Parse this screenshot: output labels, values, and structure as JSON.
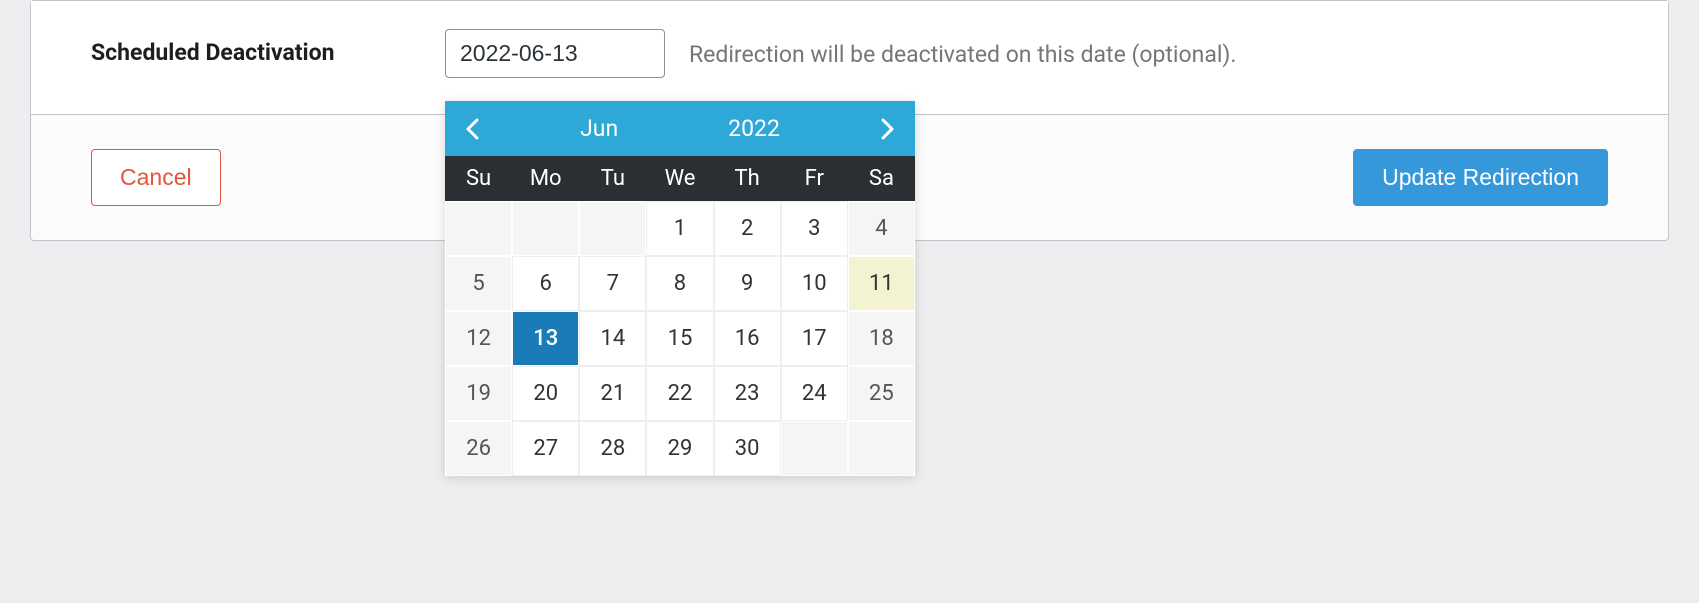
{
  "form": {
    "label": "Scheduled Deactivation",
    "date_value": "2022-06-13",
    "hint": "Redirection will be deactivated on this date (optional)."
  },
  "footer": {
    "cancel_label": "Cancel",
    "submit_label": "Update Redirection"
  },
  "datepicker": {
    "month": "Jun",
    "year": "2022",
    "dow": [
      "Su",
      "Mo",
      "Tu",
      "We",
      "Th",
      "Fr",
      "Sa"
    ],
    "weeks": [
      [
        {
          "d": "",
          "type": "empty weekend"
        },
        {
          "d": "",
          "type": "empty"
        },
        {
          "d": "",
          "type": "empty"
        },
        {
          "d": "1",
          "type": ""
        },
        {
          "d": "2",
          "type": ""
        },
        {
          "d": "3",
          "type": ""
        },
        {
          "d": "4",
          "type": "weekend"
        }
      ],
      [
        {
          "d": "5",
          "type": "weekend"
        },
        {
          "d": "6",
          "type": ""
        },
        {
          "d": "7",
          "type": ""
        },
        {
          "d": "8",
          "type": ""
        },
        {
          "d": "9",
          "type": ""
        },
        {
          "d": "10",
          "type": ""
        },
        {
          "d": "11",
          "type": "today"
        }
      ],
      [
        {
          "d": "12",
          "type": "weekend"
        },
        {
          "d": "13",
          "type": "selected"
        },
        {
          "d": "14",
          "type": ""
        },
        {
          "d": "15",
          "type": ""
        },
        {
          "d": "16",
          "type": ""
        },
        {
          "d": "17",
          "type": ""
        },
        {
          "d": "18",
          "type": "weekend"
        }
      ],
      [
        {
          "d": "19",
          "type": "weekend"
        },
        {
          "d": "20",
          "type": ""
        },
        {
          "d": "21",
          "type": ""
        },
        {
          "d": "22",
          "type": ""
        },
        {
          "d": "23",
          "type": ""
        },
        {
          "d": "24",
          "type": ""
        },
        {
          "d": "25",
          "type": "weekend"
        }
      ],
      [
        {
          "d": "26",
          "type": "weekend"
        },
        {
          "d": "27",
          "type": ""
        },
        {
          "d": "28",
          "type": ""
        },
        {
          "d": "29",
          "type": ""
        },
        {
          "d": "30",
          "type": ""
        },
        {
          "d": "",
          "type": "empty"
        },
        {
          "d": "",
          "type": "empty weekend"
        }
      ]
    ]
  }
}
